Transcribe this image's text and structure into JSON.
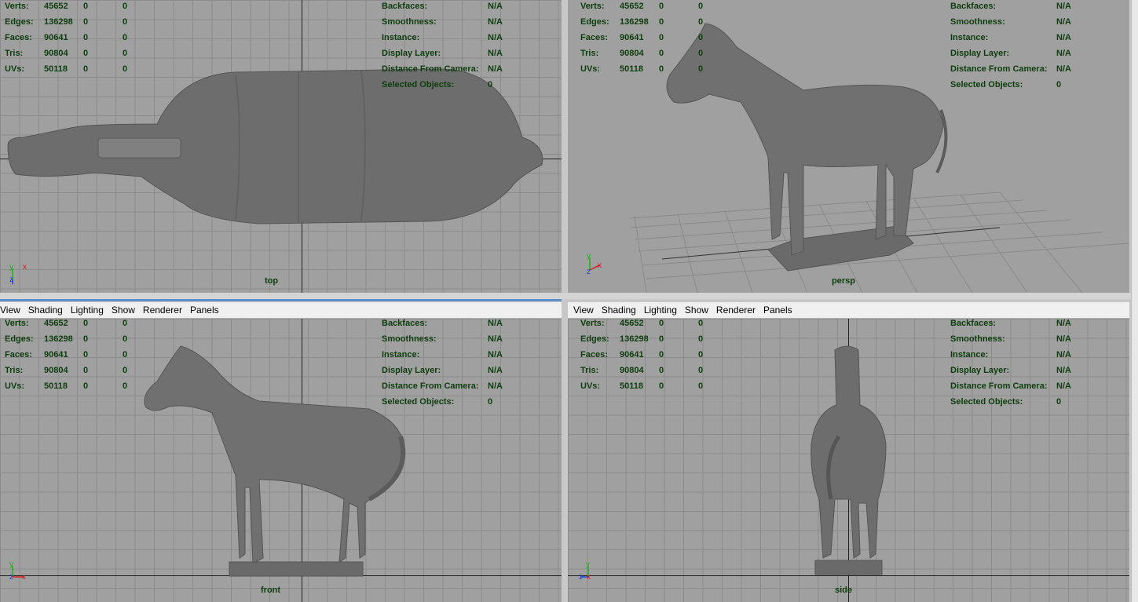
{
  "hud_left_labels": [
    "Verts:",
    "Edges:",
    "Faces:",
    "Tris:",
    "UVs:"
  ],
  "hud_left_values": [
    [
      "45652",
      "0",
      "0"
    ],
    [
      "136298",
      "0",
      "0"
    ],
    [
      "90641",
      "0",
      "0"
    ],
    [
      "90804",
      "0",
      "0"
    ],
    [
      "50118",
      "0",
      "0"
    ]
  ],
  "hud_right_labels": [
    "Backfaces:",
    "Smoothness:",
    "Instance:",
    "Display Layer:",
    "Distance From Camera:",
    "Selected Objects:"
  ],
  "hud_right_values": [
    "N/A",
    "N/A",
    "N/A",
    "N/A",
    "N/A",
    "0"
  ],
  "menu": [
    "View",
    "Shading",
    "Lighting",
    "Show",
    "Renderer",
    "Panels"
  ],
  "views": {
    "top": {
      "camera": "top"
    },
    "persp": {
      "camera": "persp"
    },
    "front": {
      "camera": "front"
    },
    "side": {
      "camera": "side"
    }
  },
  "gizmo": {
    "x": "x",
    "y": "y",
    "z": "z"
  },
  "colors": {
    "viewport_bg": "#a0a0a0",
    "hud_text": "#0d3d0d",
    "axis_x": "#cc2020",
    "axis_y": "#20b020",
    "axis_z": "#2040d0"
  }
}
